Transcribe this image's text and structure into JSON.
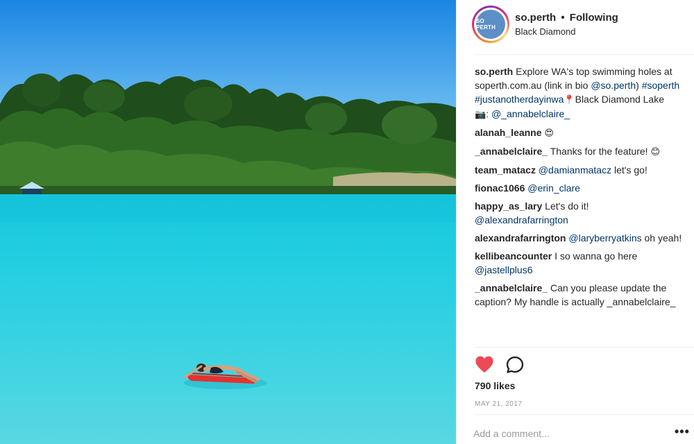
{
  "photo": {
    "description_icon": "lake-photo"
  },
  "header": {
    "avatar_text": "SO PERTH",
    "username": "so.perth",
    "dot": "•",
    "follow_label": "Following",
    "location": "Black Diamond"
  },
  "caption": {
    "user": "so.perth",
    "text1": " Explore WA's top swimming holes at soperth.com.au (link in bio ",
    "mention1": "@so.perth",
    "text2": ") ",
    "tag1": "#soperth",
    "space": " ",
    "tag2": "#justanotherdayinwa",
    "pin": " 📍",
    "text3": "Black Diamond Lake",
    "camera": "📷",
    "text4": ": ",
    "mention2": "@_annabelclaire_"
  },
  "comments": [
    {
      "user": "alanah_leanne",
      "text": " ",
      "emoji": "😍",
      "link": "",
      "tail": ""
    },
    {
      "user": "_annabelclaire_",
      "text": " Thanks for the feature! ",
      "emoji": "😊",
      "link": "",
      "tail": ""
    },
    {
      "user": "team_matacz",
      "text": " ",
      "emoji": "",
      "link": "@damianmatacz",
      "tail": " let's go!"
    },
    {
      "user": "fionac1066",
      "text": " ",
      "emoji": "",
      "link": "@erin_clare",
      "tail": ""
    },
    {
      "user": "happy_as_lary",
      "text": " Let's do it! ",
      "emoji": "",
      "link": "@alexandrafarrington",
      "tail": ""
    },
    {
      "user": "alexandrafarrington",
      "text": " ",
      "emoji": "",
      "link": "@laryberryatkins",
      "tail": " oh yeah!"
    },
    {
      "user": "kellibeancounter",
      "text": " I so wanna go here ",
      "emoji": "",
      "link": "@jastellplus6",
      "tail": ""
    },
    {
      "user": "_annabelclaire_",
      "text": " Can you please update the caption? My handle is actually _annabelclaire_",
      "emoji": "",
      "link": "",
      "tail": ""
    }
  ],
  "actions": {
    "like_icon": "heart-icon",
    "comment_icon": "comment-icon",
    "likes": "790 likes",
    "date": "MAY 21, 2017",
    "add_comment_placeholder": "Add a comment...",
    "more": "•••"
  },
  "colors": {
    "heart": "#ed4956",
    "link": "#003569",
    "water": "#2fd3e0",
    "sky": "#1e90e8"
  }
}
